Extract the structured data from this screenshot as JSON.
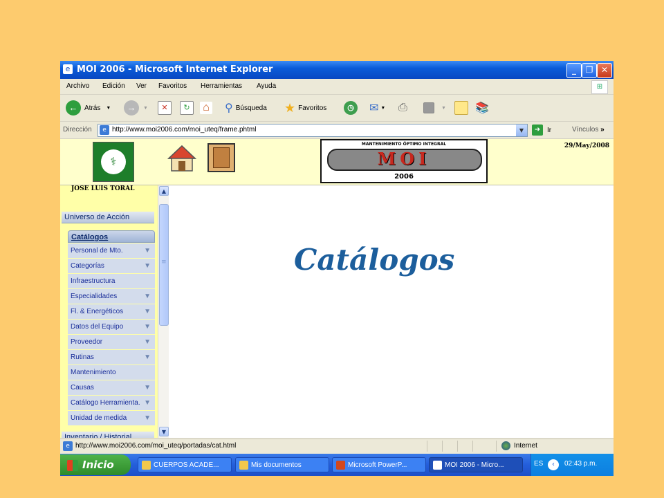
{
  "window": {
    "title": "MOI 2006 - Microsoft Internet Explorer"
  },
  "menu": [
    "Archivo",
    "Edición",
    "Ver",
    "Favoritos",
    "Herramientas",
    "Ayuda"
  ],
  "toolbar": {
    "back_label": "Atrás",
    "search_label": "Búsqueda",
    "favorites_label": "Favoritos"
  },
  "address": {
    "label": "Dirección",
    "url": "http://www.moi2006.com/moi_uteq/frame.phtml",
    "go_label": "Ir",
    "links_label": "Vínculos"
  },
  "page": {
    "logo": {
      "top_text": "MANTENIMIENTO ÓPTIMO INTEGRAL",
      "name": "MOI",
      "year": "2006"
    },
    "date": "29/May/2008",
    "username": "JOSE LUIS TORAL",
    "sidebar": {
      "section1": "Universo de Acción",
      "catalog_header": "Catálogos",
      "items": [
        {
          "label": "Personal de Mto.",
          "expand": true
        },
        {
          "label": "Categorías",
          "expand": true
        },
        {
          "label": "Infraestructura",
          "expand": false
        },
        {
          "label": "Especialidades",
          "expand": true
        },
        {
          "label": "Fl. & Energéticos",
          "expand": true
        },
        {
          "label": "Datos del Equipo",
          "expand": true
        },
        {
          "label": "Proveedor",
          "expand": true
        },
        {
          "label": "Rutinas",
          "expand": true
        },
        {
          "label": "Mantenimiento",
          "expand": false
        },
        {
          "label": "Causas",
          "expand": true
        },
        {
          "label": "Catálogo Herramienta.",
          "expand": true
        },
        {
          "label": "Unidad de medida",
          "expand": true
        }
      ],
      "section2": "Inventario / Historial"
    },
    "heading": "Catálogos"
  },
  "status": {
    "url": "http://www.moi2006.com/moi_uteq/portadas/cat.html",
    "zone": "Internet"
  },
  "taskbar": {
    "start_label": "Inicio",
    "tasks": [
      {
        "label": "CUERPOS ACADE...",
        "active": false,
        "color": "#F2C84B"
      },
      {
        "label": "Mis documentos",
        "active": false,
        "color": "#F2C84B"
      },
      {
        "label": "Microsoft PowerP...",
        "active": false,
        "color": "#D2471E"
      },
      {
        "label": "MOI 2006 - Micro...",
        "active": true,
        "color": "#FFFFFF"
      }
    ],
    "lang": "ES",
    "clock": "02:43 p.m."
  }
}
